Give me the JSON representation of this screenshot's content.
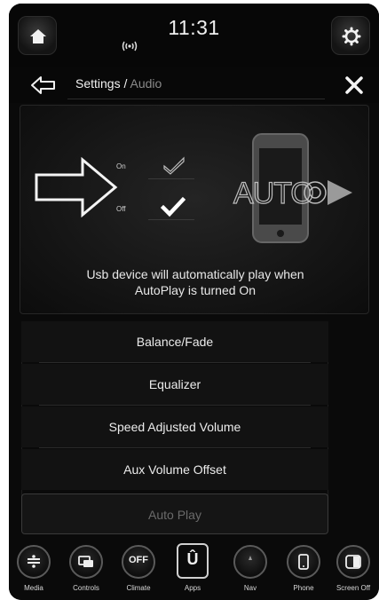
{
  "status": {
    "time": "11:31"
  },
  "breadcrumb": {
    "section": "Settings /",
    "page": "Audio"
  },
  "autoplay_panel": {
    "option_on": "On",
    "option_off": "Off",
    "selected": "Off",
    "logo_text": "AUTO",
    "description_line1": "Usb device will automatically play when",
    "description_line2": "AutoPlay is turned On"
  },
  "menu": {
    "items": [
      {
        "label": "Balance/Fade"
      },
      {
        "label": "Equalizer"
      },
      {
        "label": "Speed Adjusted Volume"
      },
      {
        "label": "Aux Volume Offset"
      },
      {
        "label": "Auto Play"
      }
    ]
  },
  "dock": {
    "items": [
      {
        "label": "Media",
        "icon": "media-icon"
      },
      {
        "label": "Controls",
        "icon": "controls-icon"
      },
      {
        "label": "Climate",
        "icon": "climate-off-icon",
        "text": "OFF"
      },
      {
        "label": "Apps",
        "icon": "apps-icon",
        "text": "Û"
      },
      {
        "label": "Nav",
        "icon": "nav-icon"
      },
      {
        "label": "Phone",
        "icon": "phone-icon"
      },
      {
        "label": "Screen Off",
        "icon": "screen-off-icon"
      }
    ]
  }
}
